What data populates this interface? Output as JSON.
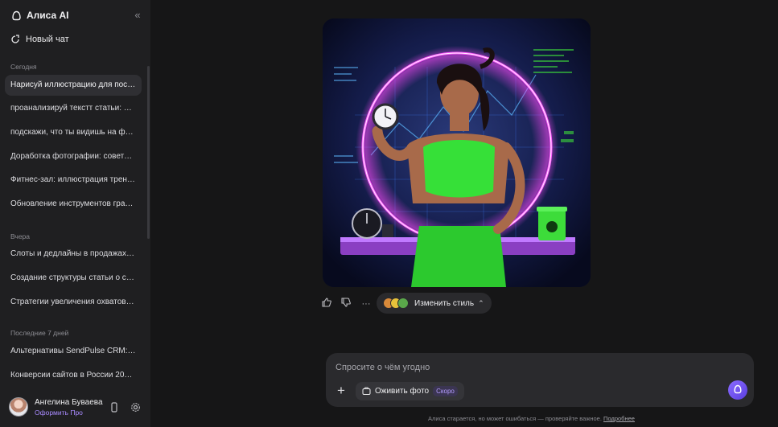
{
  "sidebar": {
    "brand": "Алиса AI",
    "new_chat": "Новый чат",
    "sections": [
      {
        "title": "Сегодня",
        "items": [
          "Нарисуй иллюстрацию для поста...",
          "проанализируй текстт статьи: По...",
          "подскажи, что ты видишь на фото",
          "Доработка фотографии: советы ...",
          "Фитнес-зал: иллюстрация трени...",
          "Обновление инструментов граф..."
        ]
      },
      {
        "title": "Вчера",
        "items": [
          "Слоты и дедлайны в продажах на ...",
          "Создание структуры статьи о ср...",
          "Стратегии увеличения охватов в ..."
        ]
      },
      {
        "title": "Последние 7 дней",
        "items": [
          "Альтернативы SendPulse CRM: об...",
          "Конверсии сайтов в России 2023-..."
        ]
      }
    ],
    "active_index": 0,
    "user": {
      "name": "Ангелина Буваева",
      "subtitle": "Оформить Про"
    }
  },
  "actions": {
    "style_button": "Изменить стиль"
  },
  "composer": {
    "placeholder": "Спросите о чём угодно",
    "animate_label": "Оживить фото",
    "animate_badge": "Скоро"
  },
  "footer": {
    "disclaimer": "Алиса старается, но может ошибаться — проверяйте важное.",
    "link": "Подробнее"
  },
  "colors": {
    "accent": "#8a6bff",
    "neon_pink": "#d34bff",
    "neon_green": "#3ddc3a"
  }
}
